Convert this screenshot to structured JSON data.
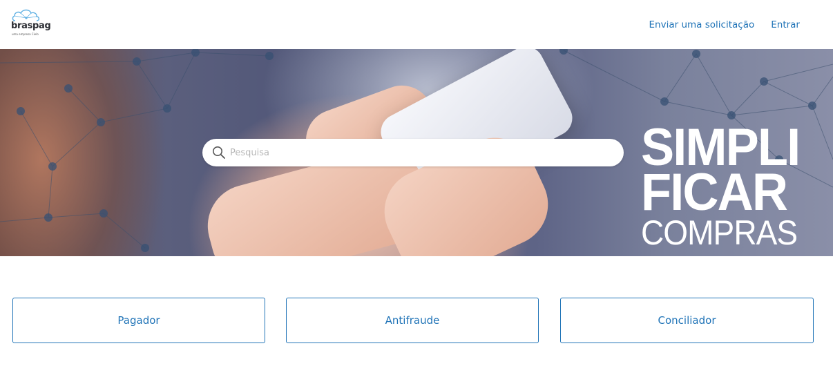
{
  "header": {
    "logo": {
      "wordmark": "braspag",
      "tagline": "uma empresa Cielo",
      "icon": "cloud-network-icon",
      "color": "#2b2d33",
      "accent": "#5fb0e3"
    },
    "nav": [
      {
        "label": "Enviar uma solicitação"
      },
      {
        "label": "Entrar"
      }
    ]
  },
  "hero": {
    "search": {
      "placeholder": "Pesquisa",
      "value": "",
      "icon": "search-icon"
    },
    "slogan": {
      "line1": "SIMPLI",
      "line2": "FICAR",
      "line3": "COMPRAS"
    }
  },
  "categories": [
    {
      "label": "Pagador"
    },
    {
      "label": "Antifraude"
    },
    {
      "label": "Conciliador"
    }
  ],
  "colors": {
    "accent": "#1f73b7",
    "background": "#ffffff"
  }
}
